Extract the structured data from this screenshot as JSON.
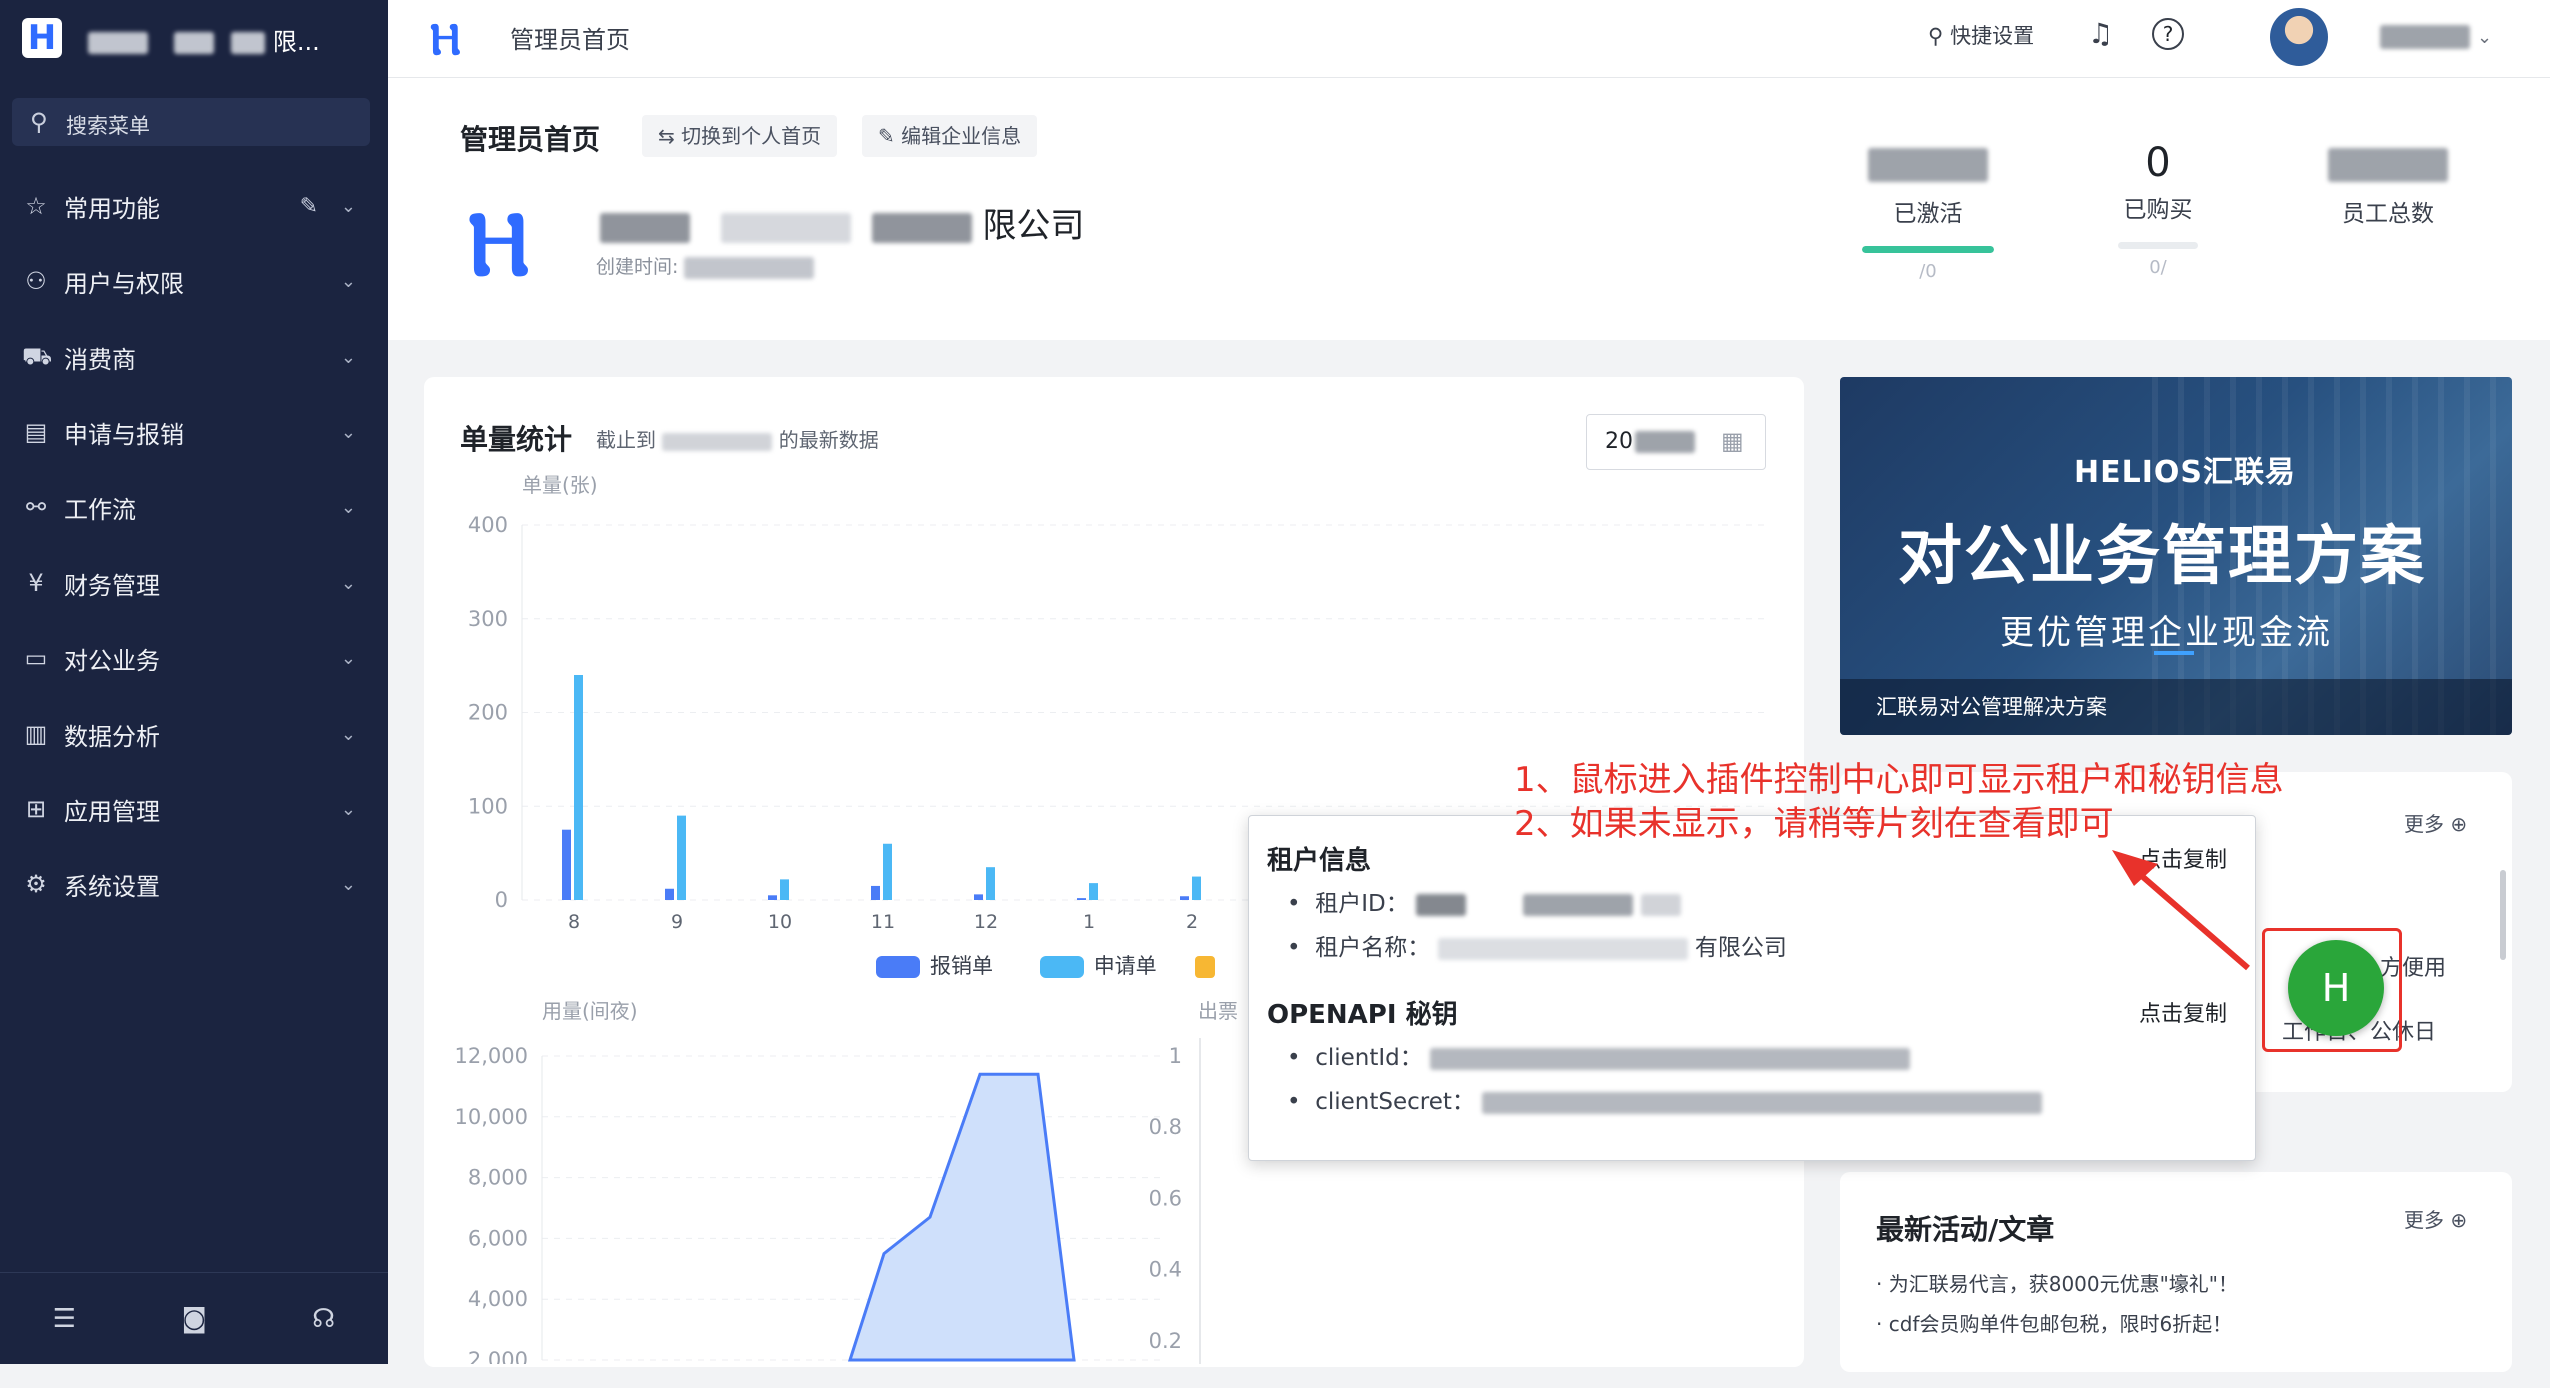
{
  "sidebar": {
    "logo_letter": "H",
    "company_short": "限...",
    "search_placeholder": "搜索菜单",
    "menu": [
      {
        "label": "常用功能",
        "icon": "star-icon"
      },
      {
        "label": "用户与权限",
        "icon": "user-icon"
      },
      {
        "label": "消费商",
        "icon": "cart-icon"
      },
      {
        "label": "申请与报销",
        "icon": "document-icon"
      },
      {
        "label": "工作流",
        "icon": "share-icon"
      },
      {
        "label": "财务管理",
        "icon": "yen-icon"
      },
      {
        "label": "对公业务",
        "icon": "monitor-icon"
      },
      {
        "label": "数据分析",
        "icon": "bar-chart-icon"
      },
      {
        "label": "应用管理",
        "icon": "grid-icon"
      },
      {
        "label": "系统设置",
        "icon": "gear-icon"
      }
    ]
  },
  "topbar": {
    "title": "管理员首页",
    "quick_settings": "快捷设置"
  },
  "header": {
    "page_title": "管理员首页",
    "switch_btn": "切换到个人首页",
    "edit_btn": "编辑企业信息",
    "company_suffix": "限公司",
    "created_label": "创建时间:",
    "stats": [
      {
        "label": "已激活",
        "value": "",
        "sub": "/0",
        "bar": 1.0
      },
      {
        "label": "已购买",
        "value": "0",
        "sub": "0/",
        "bar": 0.0
      },
      {
        "label": "员工总数",
        "value": "",
        "sub": "",
        "bar": null
      }
    ]
  },
  "stats_panel": {
    "title": "单量统计",
    "subtitle_prefix": "截止到",
    "subtitle_suffix": "的最新数据",
    "date_value": "20",
    "y_title": "单量(张)"
  },
  "chart_data": [
    {
      "type": "bar",
      "ylabel": "单量(张)",
      "ylim": [
        0,
        400
      ],
      "yticks": [
        "0",
        "100",
        "200",
        "300",
        "400"
      ],
      "categories": [
        "8",
        "9",
        "10",
        "11",
        "12",
        "1",
        "2"
      ],
      "series": [
        {
          "name": "报销单",
          "color": "#4a7cf7",
          "values": [
            75,
            12,
            5,
            15,
            6,
            2,
            4
          ]
        },
        {
          "name": "申请单",
          "color": "#4bb8f5",
          "values": [
            240,
            90,
            22,
            60,
            35,
            18,
            25
          ]
        }
      ]
    },
    {
      "type": "area",
      "ylabel": "用量(间夜)",
      "yticks": [
        "2,000",
        "4,000",
        "6,000",
        "8,000",
        "10,000",
        "12,000"
      ],
      "values": [
        2000,
        5500,
        6700,
        11400,
        11400,
        2000
      ]
    },
    {
      "type": "line",
      "ylabel": "出票",
      "yticks": [
        "0.2",
        "0.4",
        "0.6",
        "0.8",
        "1"
      ]
    }
  ],
  "banner": {
    "brand": "HELIOS汇联易",
    "headline": "对公业务管理方案",
    "sub": "更优管理企业现金流",
    "caption": "汇联易对公管理解决方案"
  },
  "annotation": {
    "line1": "1、鼠标进入插件控制中心即可显示租户和秘钥信息",
    "line2": "2、如果未显示，请稍等片刻在查看即可"
  },
  "tenant_popup": {
    "tenant_title": "租户信息",
    "copy": "点击复制",
    "tenant_id_label": "租户ID：",
    "tenant_name_label": "租户名称：",
    "tenant_name_suffix": "有限公司",
    "openapi_title": "OPENAPI 秘钥",
    "client_id_label": "clientId：",
    "client_secret_label": "clientSecret："
  },
  "plugin": {
    "letter": "H",
    "color": "#2aa63a"
  },
  "notices": {
    "more": "更多",
    "row1_suffix": "方便用",
    "row2_text": "工作日、公休日"
  },
  "articles": {
    "title": "最新活动/文章",
    "more": "更多",
    "items": [
      "· 为汇联易代言，获8000元优惠\"壕礼\"！",
      "· cdf会员购单件包邮包税，限时6折起！"
    ]
  },
  "colors": {
    "sidebar_bg": "#1b2440",
    "accent": "#2f6bff",
    "annotation_red": "#e8322b"
  }
}
